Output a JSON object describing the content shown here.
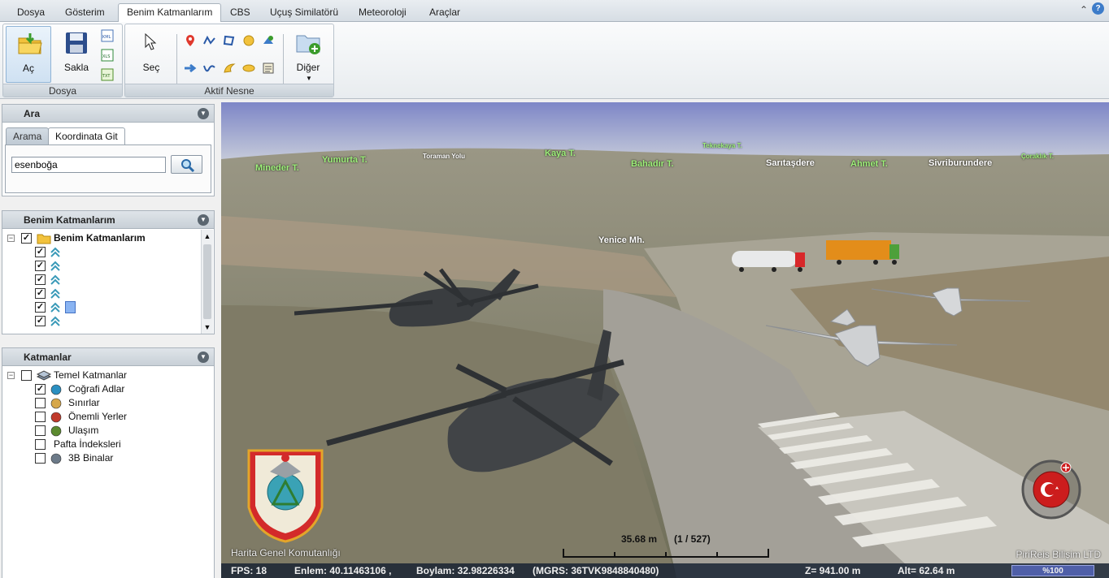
{
  "menu": {
    "tabs": [
      "Dosya",
      "Gösterim",
      "Benim Katmanlarım",
      "CBS",
      "Uçuş Similatörü",
      "Meteoroloji",
      "Araçlar"
    ]
  },
  "ribbon": {
    "file_group": {
      "label": "Dosya",
      "open": "Aç",
      "save": "Sakla",
      "kml": "KML",
      "xls": "XLS",
      "txt": "TXT"
    },
    "object_group": {
      "label": "Aktif Nesne",
      "select": "Seç",
      "other": "Diğer"
    }
  },
  "search": {
    "title": "Ara",
    "tab_search": "Arama",
    "tab_goto": "Koordinata Git",
    "value": "esenboğa"
  },
  "mylayers": {
    "title": "Benim Katmanlarım",
    "root": "Benim Katmanlarım",
    "item_count": 6
  },
  "layers": {
    "title": "Katmanlar",
    "root": "Temel Katmanlar",
    "items": [
      {
        "label": "Coğrafi Adlar",
        "checked": true,
        "icon": "globe-icon"
      },
      {
        "label": "Sınırlar",
        "checked": false,
        "icon": "boundary-icon"
      },
      {
        "label": "Önemli Yerler",
        "checked": false,
        "icon": "landmark-icon"
      },
      {
        "label": "Ulaşım",
        "checked": false,
        "icon": "transport-icon"
      },
      {
        "label": "Pafta İndeksleri",
        "checked": false,
        "icon": ""
      },
      {
        "label": "3B Binalar",
        "checked": false,
        "icon": "building-icon"
      }
    ]
  },
  "map": {
    "places": [
      {
        "name": "Mineder T.",
        "style": "green"
      },
      {
        "name": "Yumurta T.",
        "style": "green"
      },
      {
        "name": "Toraman Yolu",
        "style": "white small"
      },
      {
        "name": "Kaya T.",
        "style": "green"
      },
      {
        "name": "Teknekaya T.",
        "style": "green small"
      },
      {
        "name": "Bahadır T.",
        "style": "green"
      },
      {
        "name": "Sarıtaşdere",
        "style": "white"
      },
      {
        "name": "Ahmet T.",
        "style": "green"
      },
      {
        "name": "Sivriburundere",
        "style": "white"
      },
      {
        "name": "Çoraklık T.",
        "style": "green small"
      },
      {
        "name": "Yenice Mh.",
        "style": "white"
      }
    ],
    "scale": "35.68 m",
    "scale_page": "(1 / 527)",
    "logo_caption": "Harita Genel Komutanlığı",
    "credit": "PiriReis Bilişim LTD",
    "zoom": "%100",
    "status": {
      "fps": "FPS: 18",
      "lat": "Enlem: 40.11463106 ,",
      "lon": "Boylam: 32.98226334",
      "mgrs": "(MGRS: 36TVK9848840480)",
      "z": "Z= 941.00 m",
      "alt": "Alt= 62.64 m"
    }
  }
}
